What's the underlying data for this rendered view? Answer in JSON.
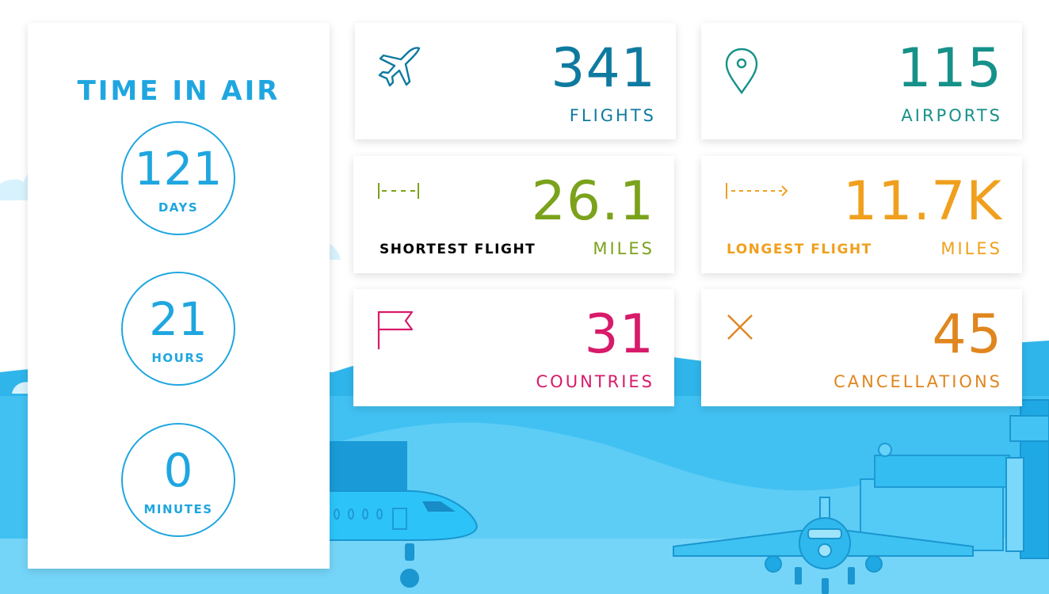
{
  "colors": {
    "blue": "#1fa6e0",
    "teal_dark": "#0f7aa0",
    "teal": "#169189",
    "green": "#7ba21b",
    "orange": "#f0a01e",
    "pink": "#d81a6a",
    "dark_orange": "#e0861f"
  },
  "time_in_air": {
    "title": "TIME IN AIR",
    "days": {
      "value": "121",
      "unit": "DAYS"
    },
    "hours": {
      "value": "21",
      "unit": "HOURS"
    },
    "minutes": {
      "value": "0",
      "unit": "MINUTES"
    }
  },
  "stats": {
    "flights": {
      "value": "341",
      "label": "FLIGHTS",
      "icon": "airplane-icon"
    },
    "airports": {
      "value": "115",
      "label": "AIRPORTS",
      "icon": "map-pin-icon"
    },
    "shortest": {
      "value": "26.1",
      "label": "MILES",
      "sub": "SHORTEST FLIGHT",
      "icon": "short-distance-icon"
    },
    "longest": {
      "value": "11.7K",
      "label": "MILES",
      "sub": "LONGEST FLIGHT",
      "icon": "long-distance-icon"
    },
    "countries": {
      "value": "31",
      "label": "COUNTRIES",
      "icon": "flag-icon"
    },
    "cancellations": {
      "value": "45",
      "label": "CANCELLATIONS",
      "icon": "x-icon"
    }
  }
}
